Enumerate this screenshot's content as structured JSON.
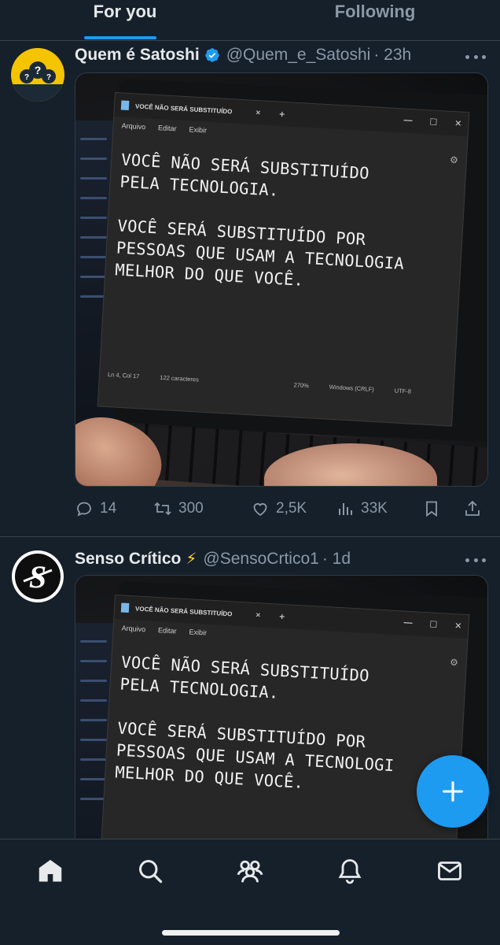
{
  "tabs": [
    {
      "label": "For you",
      "active": true
    },
    {
      "label": "Following",
      "active": false
    }
  ],
  "colors": {
    "accent": "#1d9bf0",
    "background": "#15202b",
    "verified": "#1d9bf0",
    "lightning": "#ffd43b"
  },
  "posts": [
    {
      "display_name": "Quem é Satoshi",
      "verified": true,
      "handle": "@Quem_e_Satoshi",
      "time": "· 23h",
      "avatar_icon": "question-mark-people-avatar",
      "image": {
        "window_title": "VOCÊ NÃO SERÁ SUBSTITUÍDO",
        "menu": [
          "Arquivo",
          "Editar",
          "Exibir"
        ],
        "lines": [
          "VOCÊ NÃO SERÁ SUBSTITUÍDO",
          "PELA TECNOLOGIA.",
          "",
          "VOCÊ SERÁ SUBSTITUÍDO POR",
          "PESSOAS QUE USAM A TECNOLOGIA",
          "MELHOR DO QUE VOCÊ."
        ],
        "status": {
          "position": "Ln 4, Col 17",
          "chars": "122 caracteres",
          "zoom": "270%",
          "eol": "Windows (CRLF)",
          "encoding": "UTF-8"
        }
      },
      "stats": {
        "replies": "14",
        "reposts": "300",
        "likes": "2,5K",
        "views": "33K"
      }
    },
    {
      "display_name": "Senso Crítico",
      "emoji": "⚡",
      "handle": "@SensoCrtico1",
      "time": "· 1d",
      "avatar_icon": "s-logo-avatar",
      "image": {
        "window_title": "VOCÊ NÃO SERÁ SUBSTITUÍDO",
        "menu": [
          "Arquivo",
          "Editar",
          "Exibir"
        ],
        "lines": [
          "VOCÊ NÃO SERÁ SUBSTITUÍDO",
          "PELA TECNOLOGIA.",
          "",
          "VOCÊ SERÁ SUBSTITUÍDO POR",
          "PESSOAS QUE USAM A TECNOLOGI",
          "MELHOR DO QUE VOCÊ."
        ]
      }
    }
  ],
  "fab": {
    "icon": "plus-icon"
  },
  "bottom_nav": [
    {
      "icon": "home-icon"
    },
    {
      "icon": "search-icon"
    },
    {
      "icon": "communities-icon"
    },
    {
      "icon": "notifications-bell-icon"
    },
    {
      "icon": "messages-envelope-icon"
    }
  ]
}
